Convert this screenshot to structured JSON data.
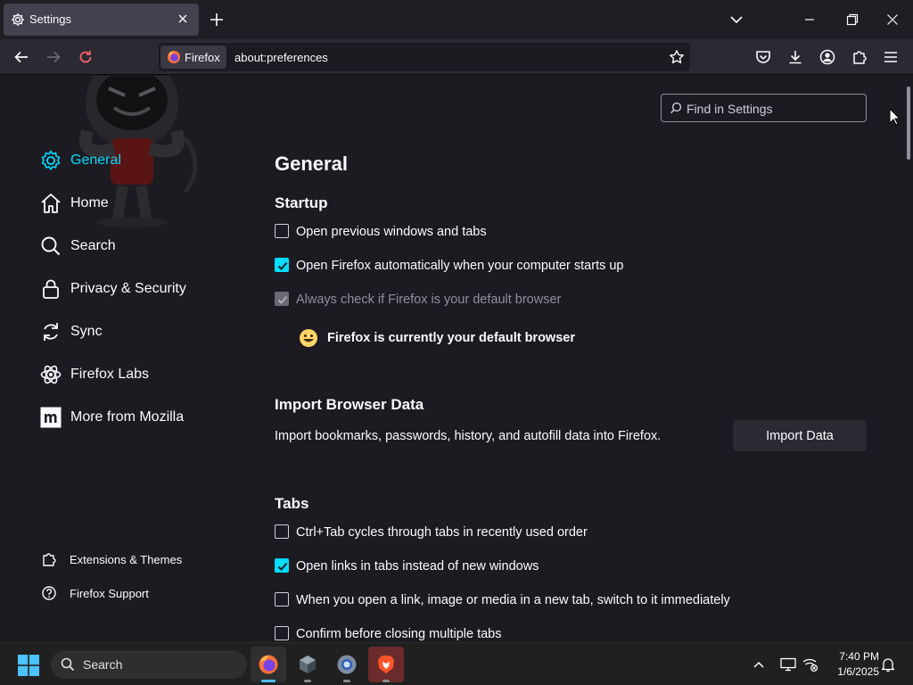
{
  "tab": {
    "title": "Settings"
  },
  "urlbar": {
    "identity_label": "Firefox",
    "url": "about:preferences"
  },
  "search": {
    "placeholder": "Find in Settings"
  },
  "sidebar": {
    "categories": [
      {
        "label": "General",
        "icon": "gear-icon",
        "selected": true
      },
      {
        "label": "Home",
        "icon": "home-icon"
      },
      {
        "label": "Search",
        "icon": "search-icon"
      },
      {
        "label": "Privacy & Security",
        "icon": "lock-icon"
      },
      {
        "label": "Sync",
        "icon": "sync-icon"
      },
      {
        "label": "Firefox Labs",
        "icon": "labs-icon"
      },
      {
        "label": "More from Mozilla",
        "icon": "mozilla-icon"
      }
    ],
    "footer": [
      {
        "label": "Extensions & Themes",
        "icon": "puzzle-icon"
      },
      {
        "label": "Firefox Support",
        "icon": "help-icon"
      }
    ]
  },
  "main": {
    "title": "General",
    "startup": {
      "heading": "Startup",
      "options": [
        {
          "label": "Open previous windows and tabs",
          "checked": false
        },
        {
          "label": "Open Firefox automatically when your computer starts up",
          "checked": true
        },
        {
          "label": "Always check if Firefox is your default browser",
          "checked": true,
          "disabled": true
        }
      ],
      "default_note": "Firefox is currently your default browser"
    },
    "import": {
      "heading": "Import Browser Data",
      "description": "Import bookmarks, passwords, history, and autofill data into Firefox.",
      "button_label": "Import Data"
    },
    "tabs": {
      "heading": "Tabs",
      "options": [
        {
          "label": "Ctrl+Tab cycles through tabs in recently used order",
          "checked": false
        },
        {
          "label": "Open links in tabs instead of new windows",
          "checked": true
        },
        {
          "label": "When you open a link, image or media in a new tab, switch to it immediately",
          "checked": false
        },
        {
          "label": "Confirm before closing multiple tabs",
          "checked": false
        }
      ]
    }
  },
  "taskbar": {
    "search_label": "Search",
    "apps": [
      "firefox-icon",
      "app-cube-icon",
      "chrome-settings-icon",
      "brave-icon"
    ],
    "clock": {
      "time": "7:40 PM",
      "date": "1/6/2025"
    }
  },
  "colors": {
    "accent": "#00ddff",
    "background": "#1c1b22",
    "toolbar": "#2b2a33",
    "taskbar_accent": "#4cc2ff"
  }
}
